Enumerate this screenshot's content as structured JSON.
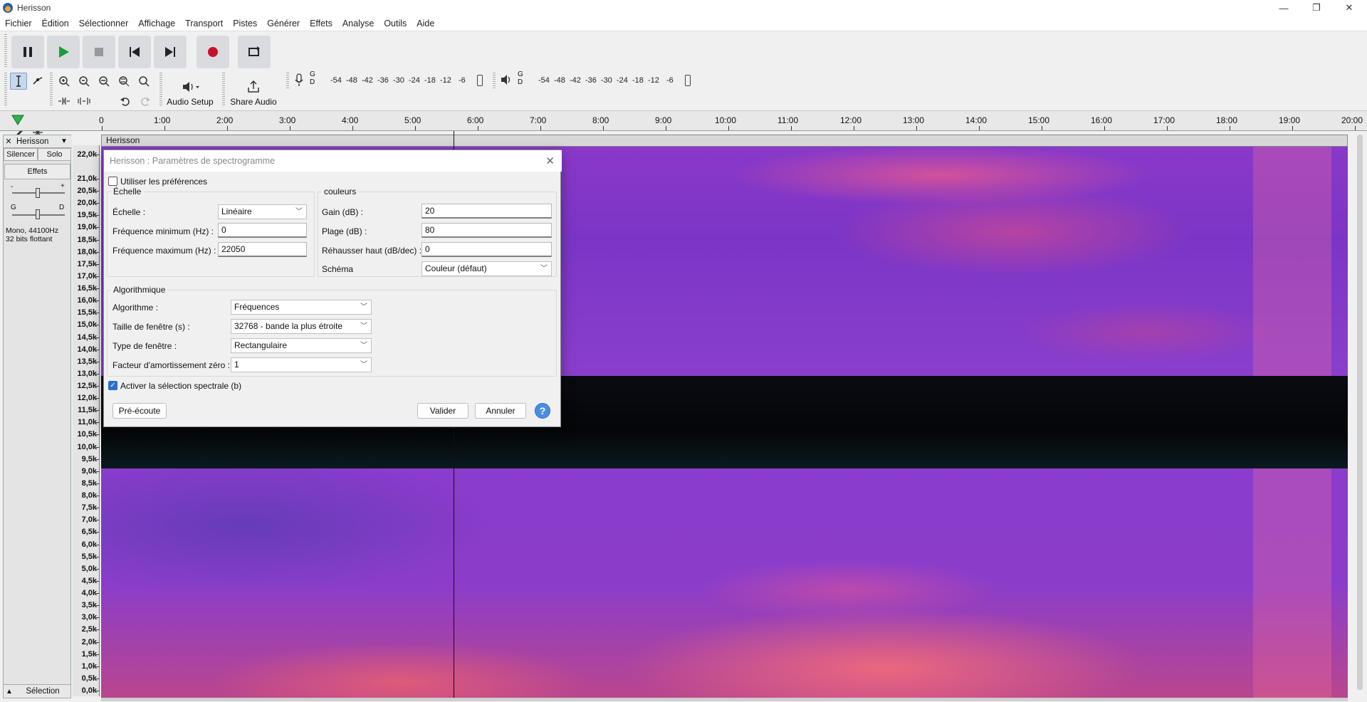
{
  "window": {
    "title": "Herisson",
    "controls": {
      "minimize": "—",
      "maximize": "❐",
      "close": "✕"
    }
  },
  "menu": [
    "Fichier",
    "Édition",
    "Sélectionner",
    "Affichage",
    "Transport",
    "Pistes",
    "Générer",
    "Effets",
    "Analyse",
    "Outils",
    "Aide"
  ],
  "toolbar": {
    "audio_setup": "Audio Setup",
    "share_audio": "Share Audio",
    "meter_channels": [
      "G",
      "D"
    ],
    "meter_ticks": [
      "-54",
      "-48",
      "-42",
      "-36",
      "-30",
      "-24",
      "-18",
      "-12",
      "-6",
      "0"
    ]
  },
  "ruler": {
    "labels": [
      "0",
      "1:00",
      "2:00",
      "3:00",
      "4:00",
      "5:00",
      "6:00",
      "7:00",
      "8:00",
      "9:00",
      "10:00",
      "11:00",
      "12:00",
      "13:00",
      "14:00",
      "15:00",
      "16:00",
      "17:00",
      "18:00",
      "19:00",
      "20:00"
    ]
  },
  "track": {
    "name": "Herisson",
    "mute": "Silencer",
    "solo": "Solo",
    "effects": "Effets",
    "pan_left": "G",
    "pan_right": "D",
    "gain_minus": "-",
    "gain_plus": "+",
    "format_line1": "Mono, 44100Hz",
    "format_line2": "32 bits flottant",
    "selection_label": "Sélection",
    "header": "Herisson"
  },
  "freq_scale": [
    "22,0k",
    "21,0k",
    "20,5k",
    "20,0k",
    "19,5k",
    "19,0k",
    "18,5k",
    "18,0k",
    "17,5k",
    "17,0k",
    "16,5k",
    "16,0k",
    "15,5k",
    "15,0k",
    "14,5k",
    "14,0k",
    "13,5k",
    "13,0k",
    "12,5k",
    "12,0k",
    "11,5k",
    "11,0k",
    "10,5k",
    "10,0k",
    "9,5k",
    "9,0k",
    "8,5k",
    "8,0k",
    "7,5k",
    "7,0k",
    "6,5k",
    "6,0k",
    "5,5k",
    "5,0k",
    "4,5k",
    "4,0k",
    "3,5k",
    "3,0k",
    "2,5k",
    "2,0k",
    "1,5k",
    "1,0k",
    "0,5k",
    "0,0k"
  ],
  "dialog": {
    "title": "Herisson : Paramètres de spectrogramme",
    "use_prefs": "Utiliser les préférences",
    "use_prefs_checked": false,
    "scale_group": "Échelle",
    "scale_label": "Échelle :",
    "scale_value": "Linéaire",
    "min_freq_label": "Fréquence minimum (Hz) :",
    "min_freq_value": "0",
    "max_freq_label": "Fréquence maximum (Hz) :",
    "max_freq_value": "22050",
    "colors_group": "couleurs",
    "gain_label": "Gain (dB) :",
    "gain_value": "20",
    "range_label": "Plage (dB) :",
    "range_value": "80",
    "boost_label": "Réhausser haut (dB/dec) :",
    "boost_value": "0",
    "scheme_label": "Schéma",
    "scheme_value": "Couleur (défaut)",
    "algo_group": "Algorithmique",
    "algo_label": "Algorithme :",
    "algo_value": "Fréquences",
    "window_size_label": "Taille de fenêtre (s) :",
    "window_size_value": "32768 - bande la plus étroite",
    "window_type_label": "Type de fenêtre :",
    "window_type_value": "Rectangulaire",
    "zero_pad_label": "Facteur d'amortissement zéro :",
    "zero_pad_value": "1",
    "spectral_sel": "Activer la sélection spectrale (b)",
    "spectral_sel_checked": true,
    "preview_button": "Pré-écoute",
    "ok_button": "Valider",
    "cancel_button": "Annuler",
    "help_button": "?"
  }
}
